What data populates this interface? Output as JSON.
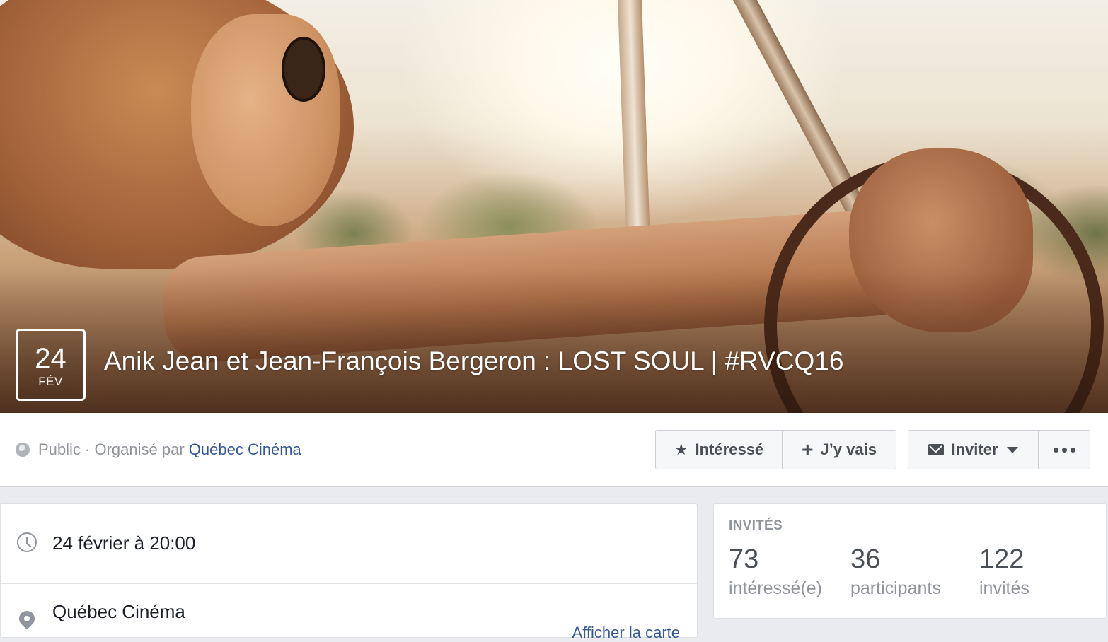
{
  "event": {
    "date_day": "24",
    "date_month": "FÉV",
    "title": "Anik Jean et Jean-François Bergeron : LOST SOUL | #RVCQ16"
  },
  "meta": {
    "privacy": "Public",
    "separator": " · ",
    "organized_by": "Organisé par ",
    "organizer": "Québec Cinéma"
  },
  "actions": {
    "interested": "Intéressé",
    "going": "J’y vais",
    "invite": "Inviter"
  },
  "details": {
    "datetime": "24 février à 20:00",
    "location": "Québec Cinéma",
    "map_link": "Afficher la carte"
  },
  "guests": {
    "heading": "INVITÉS",
    "stats": [
      {
        "value": "73",
        "label": "intéressé(e)"
      },
      {
        "value": "36",
        "label": "participants"
      },
      {
        "value": "122",
        "label": "invités"
      }
    ]
  },
  "colors": {
    "link": "#365899",
    "muted": "#90949c",
    "button_text": "#4b4f56"
  }
}
